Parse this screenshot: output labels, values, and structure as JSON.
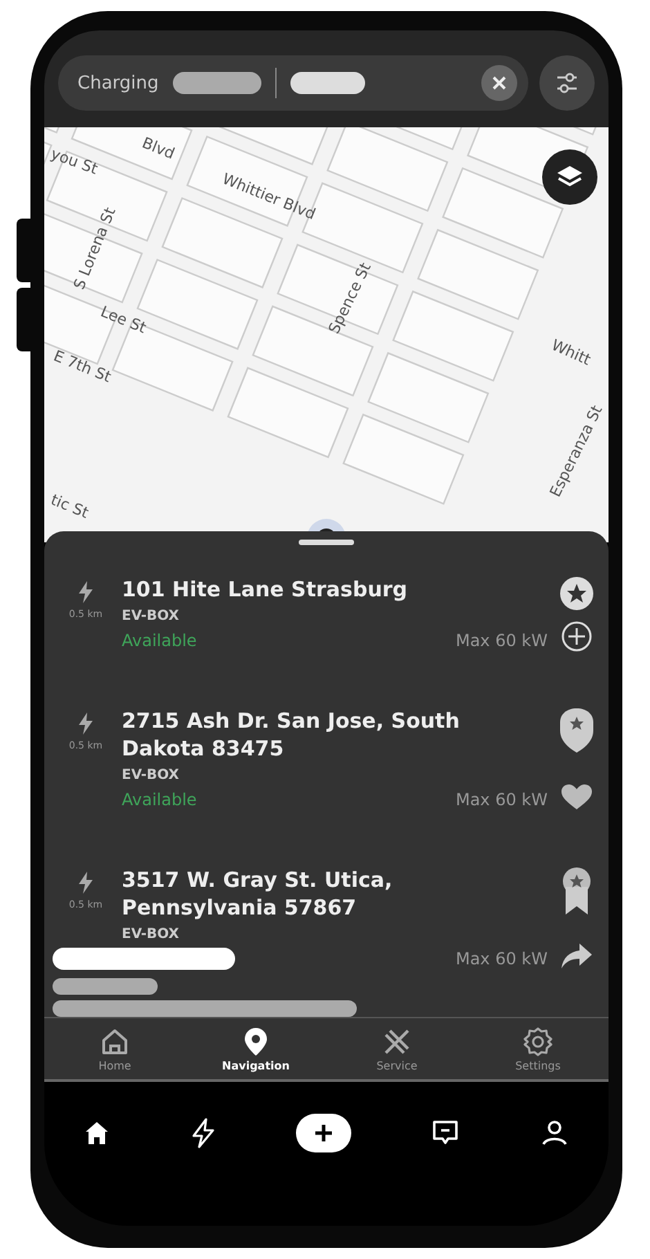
{
  "search_bar": {
    "label": "Charging"
  },
  "map": {
    "street_labels": [
      "you St",
      "Blvd",
      "Whittier Blvd",
      "S Lorena St",
      "Lee St",
      "E 7th St",
      "Spence St",
      "Whitt",
      "Esperanza St",
      "tic St"
    ]
  },
  "stations": [
    {
      "distance": "0.5 km",
      "address": "101 Hite Lane Strasburg",
      "operator": "EV-BOX",
      "status": "Available",
      "power": "Max 60 kW"
    },
    {
      "distance": "0.5 km",
      "address": "2715 Ash Dr. San Jose, South Dakota 83475",
      "operator": "EV-BOX",
      "status": "Available",
      "power": "Max 60 kW"
    },
    {
      "distance": "0.5 km",
      "address": "3517 W. Gray St. Utica, Pennsylvania 57867",
      "operator": "EV-BOX",
      "power": "Max 60 kW"
    }
  ],
  "nav_tabs": [
    {
      "label": "Home",
      "selected": false
    },
    {
      "label": "Navigation",
      "selected": true
    },
    {
      "label": "Service",
      "selected": false
    },
    {
      "label": "Settings",
      "selected": false
    }
  ]
}
